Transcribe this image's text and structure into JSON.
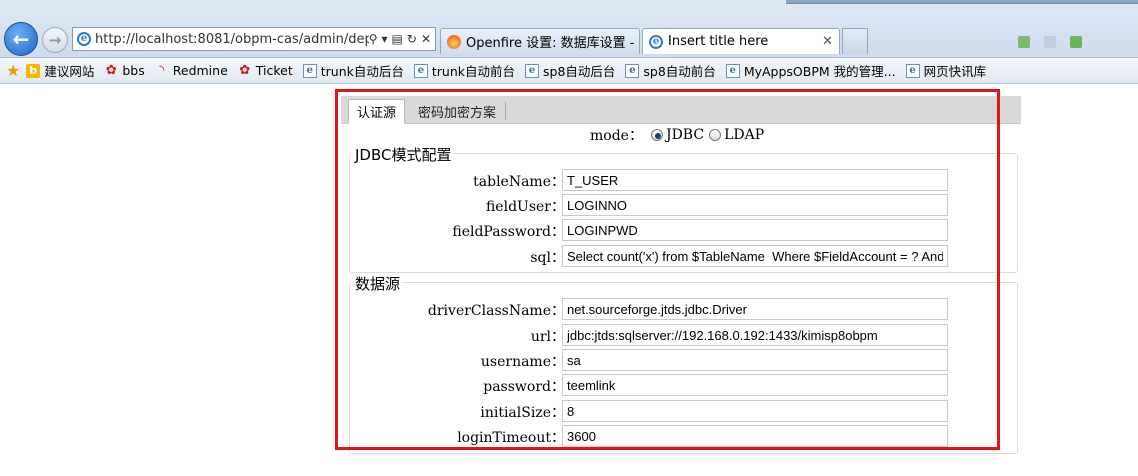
{
  "browser": {
    "address_url": "http://localhost:8081/obpm-cas/admin/dep",
    "tabs": [
      {
        "title": "Openfire 设置: 数据库设置 - ...",
        "active": false
      },
      {
        "title": "Insert title here",
        "active": true
      }
    ]
  },
  "favorites": [
    {
      "label": "建议网站",
      "icon": "bing-icon"
    },
    {
      "label": "bbs",
      "icon": "bug-icon"
    },
    {
      "label": "Redmine",
      "icon": "redmine-icon"
    },
    {
      "label": "Ticket",
      "icon": "bug-icon"
    },
    {
      "label": "trunk自动后台",
      "icon": "page-icon"
    },
    {
      "label": "trunk自动前台",
      "icon": "page-icon"
    },
    {
      "label": "sp8自动后台",
      "icon": "page-icon"
    },
    {
      "label": "sp8自动前台",
      "icon": "page-icon"
    },
    {
      "label": "MyAppsOBPM 我的管理...",
      "icon": "page-icon"
    },
    {
      "label": "网页快讯库",
      "icon": "page-icon"
    }
  ],
  "page": {
    "tabs": [
      "认证源",
      "密码加密方案"
    ],
    "mode_label": "mode：",
    "mode_options": [
      {
        "label": "JDBC",
        "selected": true
      },
      {
        "label": "LDAP",
        "selected": false
      }
    ],
    "jdbc_group": {
      "legend": "JDBC模式配置",
      "fields": [
        {
          "label": "tableName：",
          "value": "T_USER"
        },
        {
          "label": "fieldUser：",
          "value": "LOGINNO"
        },
        {
          "label": "fieldPassword：",
          "value": "LOGINPWD"
        },
        {
          "label": "sql：",
          "value": "Select count('x') from $TableName  Where $FieldAccount = ? And $FieldPassword = ?"
        }
      ]
    },
    "datasource_group": {
      "legend": "数据源",
      "fields": [
        {
          "label": "driverClassName：",
          "value": "net.sourceforge.jtds.jdbc.Driver"
        },
        {
          "label": "url：",
          "value": "jdbc:jtds:sqlserver://192.168.0.192:1433/kimisp8obpm"
        },
        {
          "label": "username：",
          "value": "sa"
        },
        {
          "label": "password：",
          "value": "teemlink"
        },
        {
          "label": "initialSize：",
          "value": "8"
        },
        {
          "label": "loginTimeout：",
          "value": "3600"
        }
      ]
    }
  },
  "colors": {
    "highlight_frame": "#e0161b",
    "tabstrip_bg": "#d9d9d9"
  }
}
